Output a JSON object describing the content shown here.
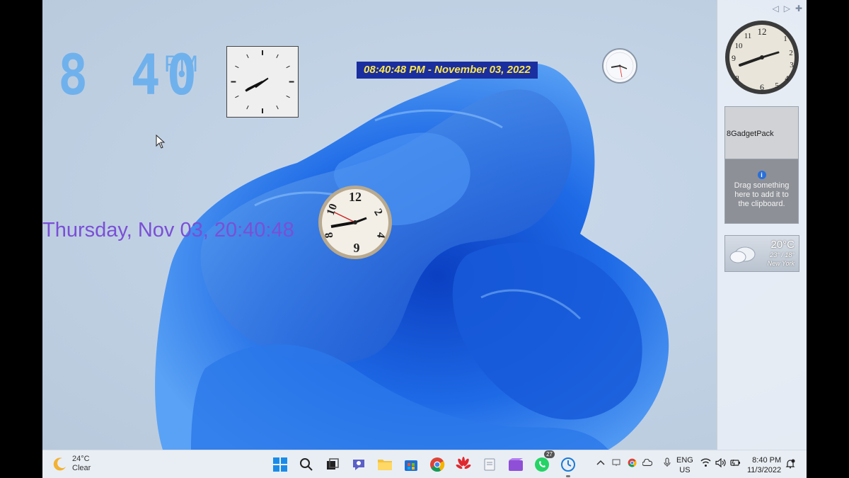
{
  "desktop": {
    "led_clock": {
      "digits": "8 40",
      "ampm": "PM"
    },
    "date_banner": "08:40:48 PM - November 03, 2022",
    "purple_date": "Thursday, Nov 03, 20:40:48"
  },
  "sidebar": {
    "controls": {
      "prev": "◁",
      "next": "▷",
      "add": "✚"
    },
    "gadget_pack": {
      "title": "8GadgetPack",
      "info_text": "Drag something here to add it to the clipboard."
    },
    "weather": {
      "temp": "20°C",
      "range": "23° / 18°",
      "city": "New York"
    }
  },
  "taskbar": {
    "weather": {
      "temp": "24°C",
      "condition": "Clear"
    },
    "apps": [
      "start",
      "search",
      "task-view",
      "chat",
      "file-explorer",
      "store",
      "chrome",
      "huawei",
      "notepad",
      "clipchamp",
      "whatsapp",
      "clock"
    ],
    "whatsapp_badge": "27",
    "lang": {
      "line1": "ENG",
      "line2": "US"
    },
    "clock": {
      "time": "8:40 PM",
      "date": "11/3/2022"
    }
  },
  "colors": {
    "led": "#6fb1ec",
    "banner_bg": "#1a2ea0",
    "banner_text": "#ffe84a",
    "purple_text": "#7a4fd6",
    "wallpaper_blue": "#1d63e0"
  }
}
